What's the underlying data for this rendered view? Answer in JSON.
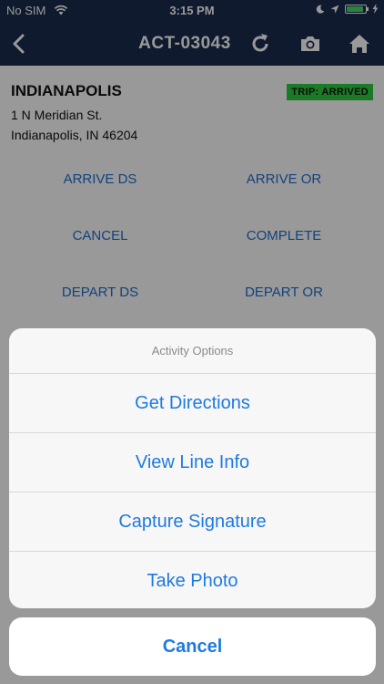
{
  "status_bar": {
    "carrier": "No SIM",
    "time": "3:15 PM",
    "battery_level": 0.9
  },
  "nav": {
    "title": "ACT-03043"
  },
  "location": {
    "name": "INDIANAPOLIS",
    "address_line1": "1 N Meridian St.",
    "address_line2": "Indianapolis, IN 46204",
    "trip_status": "TRIP: ARRIVED"
  },
  "actions": [
    {
      "label": "ARRIVE DS"
    },
    {
      "label": "ARRIVE OR"
    },
    {
      "label": "CANCEL"
    },
    {
      "label": "COMPLETE"
    },
    {
      "label": "DEPART DS"
    },
    {
      "label": "DEPART OR"
    }
  ],
  "action_sheet": {
    "title": "Activity Options",
    "options": [
      {
        "label": "Get Directions"
      },
      {
        "label": "View Line Info"
      },
      {
        "label": "Capture Signature"
      },
      {
        "label": "Take Photo"
      }
    ],
    "cancel_label": "Cancel"
  },
  "colors": {
    "nav_bg": "#1a2c4e",
    "badge_green": "#2ecc40",
    "link_blue": "#1f6fd1",
    "sheet_blue": "#1f7ae0"
  }
}
